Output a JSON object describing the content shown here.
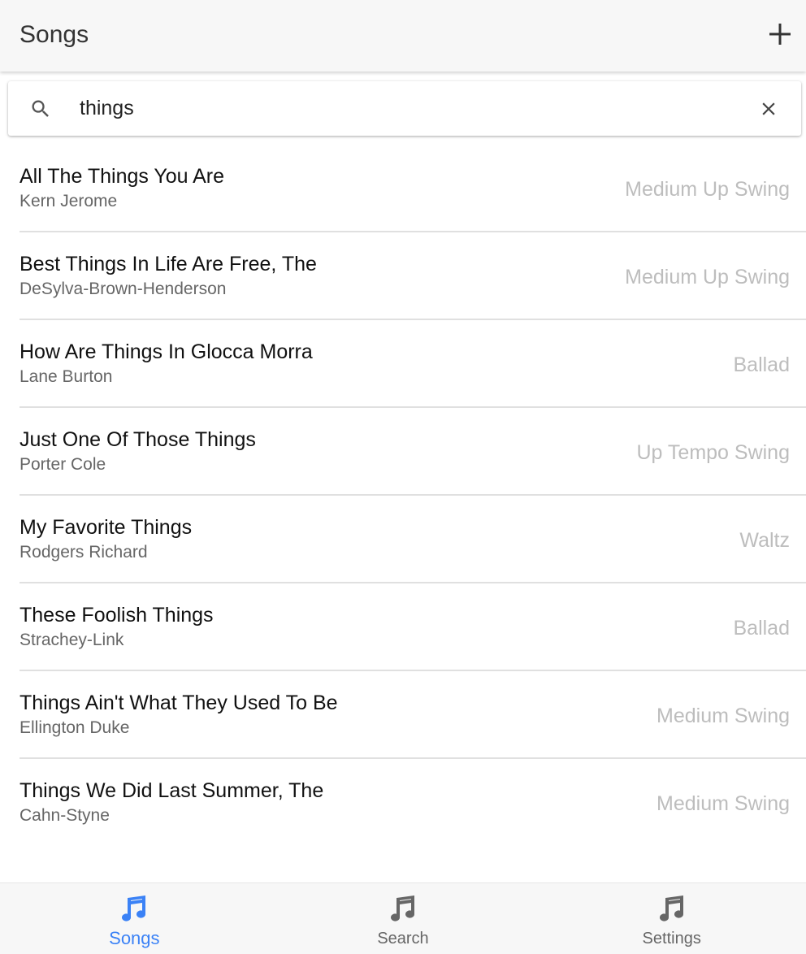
{
  "header": {
    "title": "Songs",
    "add_icon": "plus-icon"
  },
  "search": {
    "value": "things",
    "placeholder": "Search",
    "search_icon": "search-icon",
    "clear_icon": "close-icon"
  },
  "songs": [
    {
      "title": "All The Things You Are",
      "composer": "Kern Jerome",
      "style": "Medium Up Swing"
    },
    {
      "title": "Best Things In Life Are Free, The",
      "composer": "DeSylva-Brown-Henderson",
      "style": "Medium Up Swing"
    },
    {
      "title": "How Are Things In Glocca Morra",
      "composer": "Lane Burton",
      "style": "Ballad"
    },
    {
      "title": "Just One Of Those Things",
      "composer": "Porter Cole",
      "style": "Up Tempo Swing"
    },
    {
      "title": "My Favorite Things",
      "composer": "Rodgers Richard",
      "style": "Waltz"
    },
    {
      "title": "These Foolish Things",
      "composer": "Strachey-Link",
      "style": "Ballad"
    },
    {
      "title": "Things Ain't What They Used To Be",
      "composer": "Ellington Duke",
      "style": "Medium Swing"
    },
    {
      "title": "Things We Did Last Summer, The",
      "composer": "Cahn-Styne",
      "style": "Medium Swing"
    }
  ],
  "tabs": [
    {
      "label": "Songs",
      "icon": "music-note-icon",
      "active": true
    },
    {
      "label": "Search",
      "icon": "music-note-icon",
      "active": false
    },
    {
      "label": "Settings",
      "icon": "music-note-icon",
      "active": false
    }
  ],
  "colors": {
    "accent": "#3b82f6",
    "inactive_icon": "#666666",
    "style_text": "#bdbdbd",
    "header_bg": "#f7f7f7"
  }
}
